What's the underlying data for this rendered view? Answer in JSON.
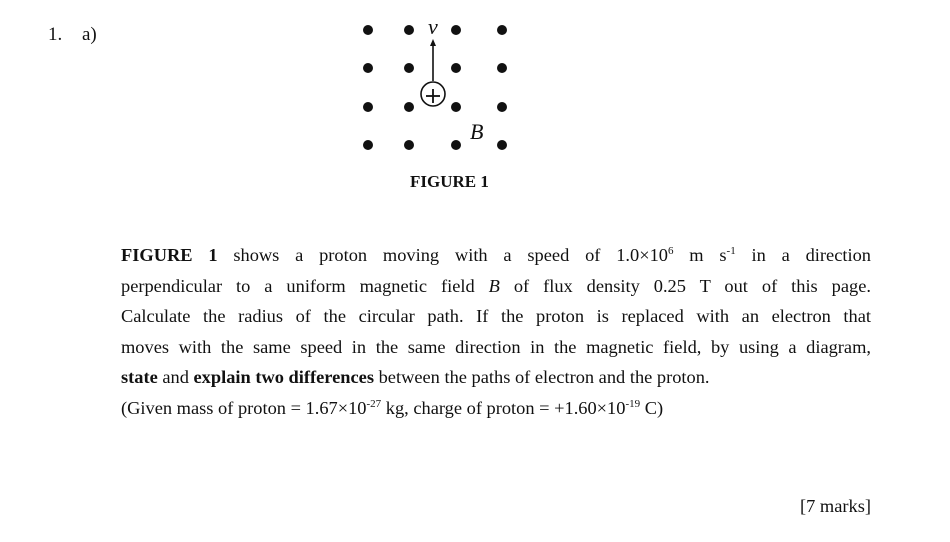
{
  "question": {
    "number": "1.",
    "part": "a)"
  },
  "figure": {
    "caption": "FIGURE 1",
    "velocity_label": "v",
    "field_label": "B",
    "particle_symbol": "+",
    "field_direction": "out of page (dots)",
    "dot_grid": {
      "rows": 4,
      "cols": 4
    }
  },
  "paragraph": {
    "line1": {
      "bold": "FIGURE 1",
      "text": " shows a proton moving with a speed of 1.0×10",
      "sup1": "6",
      "mid": " m s",
      "sup2": "-1",
      "end": " in a direction"
    },
    "line2": {
      "pre": "perpendicular to a uniform magnetic field ",
      "italic": "B",
      "post": " of flux density 0.25 T out of this page."
    },
    "line3": "Calculate the radius of the circular path. If the proton is replaced with an electron that",
    "line4": "moves with the same speed in the same direction in the magnetic field, by using a diagram,",
    "line5": {
      "bold1": "state",
      "t1": " and ",
      "bold2": "explain two differences",
      "t2": " between the paths of electron and the proton."
    },
    "line6": {
      "t1": "(Given mass of proton = 1.67×10",
      "sup1": "-27",
      "t2": " kg, charge of proton = +1.60×10",
      "sup2": "-19",
      "t3": " C)"
    }
  },
  "marks": "[7 marks]"
}
